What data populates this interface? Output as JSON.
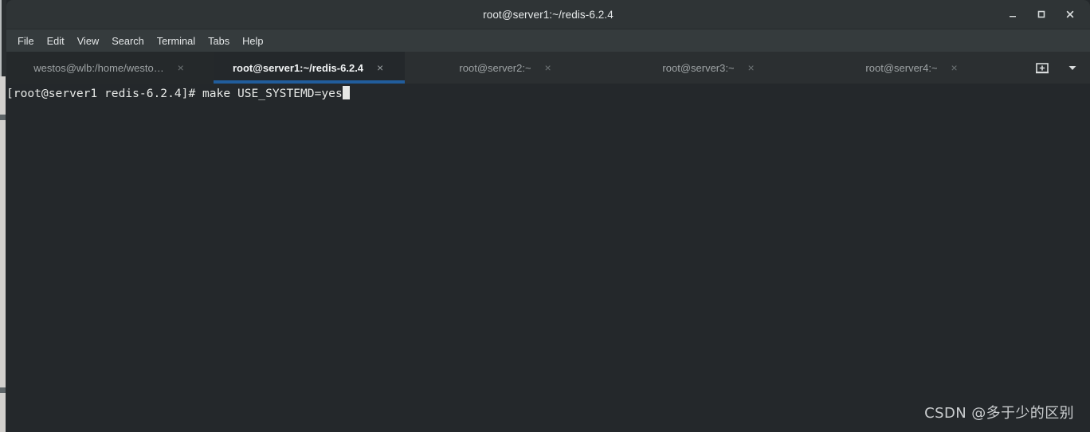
{
  "window": {
    "title": "root@server1:~/redis-6.2.4",
    "controls": {
      "minimize": "minimize",
      "maximize": "maximize",
      "close": "close"
    }
  },
  "menubar": {
    "items": [
      {
        "label": "File"
      },
      {
        "label": "Edit"
      },
      {
        "label": "View"
      },
      {
        "label": "Search"
      },
      {
        "label": "Terminal"
      },
      {
        "label": "Tabs"
      },
      {
        "label": "Help"
      }
    ]
  },
  "tabbar": {
    "tabs": [
      {
        "label": "westos@wlb:/home/westo…",
        "close": "×",
        "active": false
      },
      {
        "label": "root@server1:~/redis-6.2.4",
        "close": "×",
        "active": true
      },
      {
        "label": "root@server2:~",
        "close": "×",
        "active": false
      },
      {
        "label": "root@server3:~",
        "close": "×",
        "active": false
      },
      {
        "label": "root@server4:~",
        "close": "×",
        "active": false
      }
    ],
    "new_tab_icon": "new-terminal-tab-icon",
    "tab_list_icon": "chevron-down-icon",
    "active_indicator_color": "#215d9c"
  },
  "terminal": {
    "prompt": "[root@server1 redis-6.2.4]# ",
    "command": "make USE_SYSTEMD=yes",
    "cursor": "block",
    "background_color": "#24282b",
    "foreground_color": "#e6e8e6"
  },
  "watermark": {
    "text": "CSDN @多于少的区别"
  }
}
